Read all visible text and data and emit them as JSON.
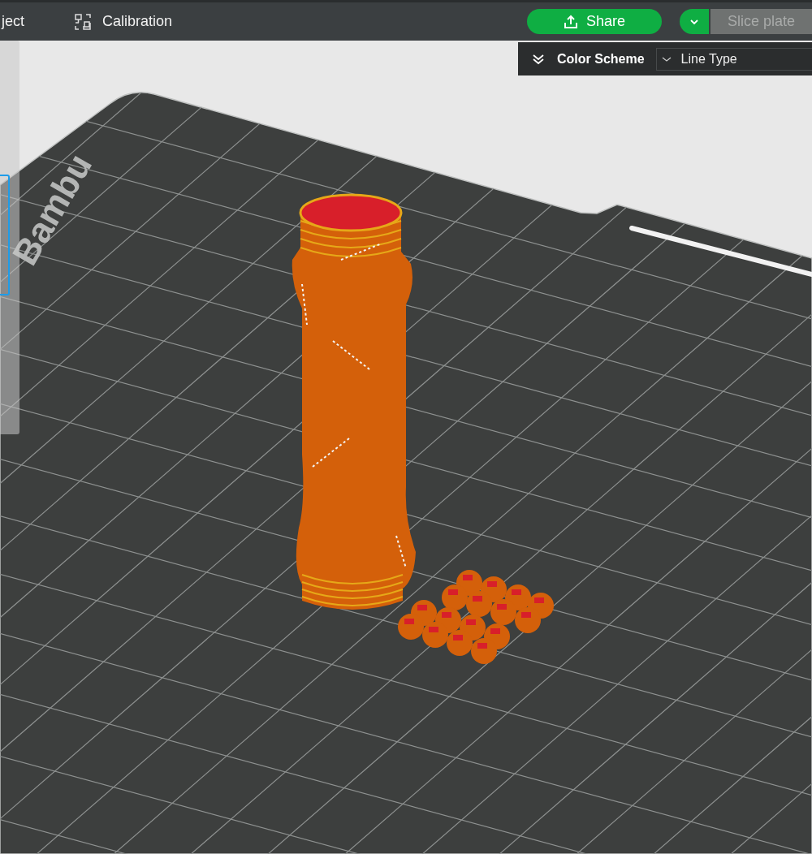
{
  "top_bar": {
    "tabs": [
      {
        "label": "ject",
        "kind": "text"
      },
      {
        "label": "Calibration",
        "kind": "calibration"
      }
    ],
    "share_button": {
      "label": "Share"
    },
    "slice_button": {
      "label": "Slice plate",
      "disabled": true
    }
  },
  "color_scheme": {
    "label": "Color Scheme",
    "value": "Line Type"
  },
  "viewport": {
    "bed_logo": "Bambu"
  }
}
